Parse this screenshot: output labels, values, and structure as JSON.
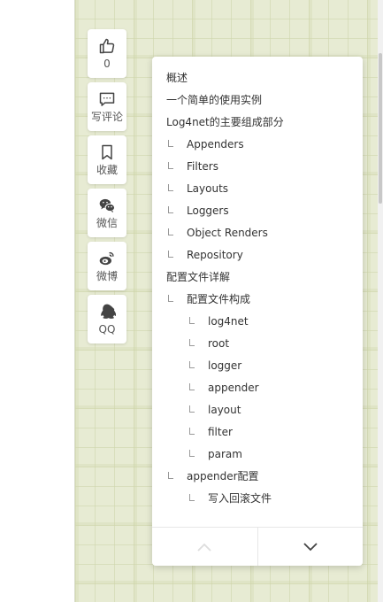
{
  "actions": {
    "like": {
      "icon": "thumbs-up-icon",
      "label": "0"
    },
    "comment": {
      "icon": "comment-icon",
      "label": "写评论"
    },
    "bookmark": {
      "icon": "bookmark-icon",
      "label": "收藏"
    },
    "wechat": {
      "icon": "wechat-icon",
      "label": "微信"
    },
    "weibo": {
      "icon": "weibo-icon",
      "label": "微博"
    },
    "qq": {
      "icon": "qq-icon",
      "label": "QQ"
    }
  },
  "toc": {
    "items": [
      {
        "level": 1,
        "text": "概述"
      },
      {
        "level": 1,
        "text": "一个简单的使用实例"
      },
      {
        "level": 1,
        "text": "Log4net的主要组成部分"
      },
      {
        "level": 2,
        "text": "Appenders"
      },
      {
        "level": 2,
        "text": "Filters"
      },
      {
        "level": 2,
        "text": "Layouts"
      },
      {
        "level": 2,
        "text": "Loggers"
      },
      {
        "level": 2,
        "text": "Object Renders"
      },
      {
        "level": 2,
        "text": "Repository"
      },
      {
        "level": 1,
        "text": "配置文件详解"
      },
      {
        "level": 2,
        "text": "配置文件构成"
      },
      {
        "level": 3,
        "text": "log4net"
      },
      {
        "level": 3,
        "text": "root"
      },
      {
        "level": 3,
        "text": "logger"
      },
      {
        "level": 3,
        "text": "appender"
      },
      {
        "level": 3,
        "text": "layout"
      },
      {
        "level": 3,
        "text": "filter"
      },
      {
        "level": 3,
        "text": "param"
      },
      {
        "level": 2,
        "text": "appender配置"
      },
      {
        "level": 3,
        "text": "写入回滚文件"
      }
    ],
    "nav": {
      "up_icon": "chevron-up-icon",
      "down_icon": "chevron-down-icon"
    }
  },
  "colors": {
    "page_background": "#e7ebd3",
    "icon": "#444444",
    "disabled_icon": "#dddddd"
  }
}
